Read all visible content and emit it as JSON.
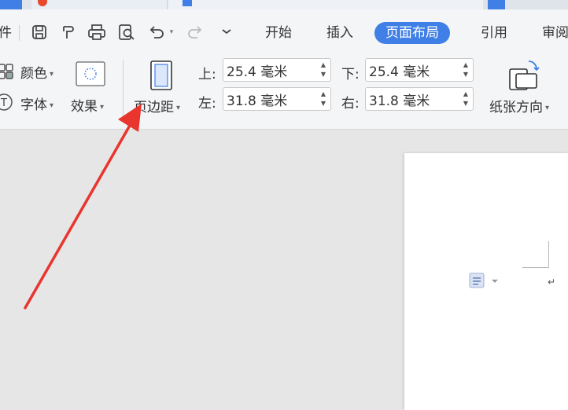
{
  "menu_tabs": {
    "partial_left": "件",
    "home": "开始",
    "insert": "插入",
    "page_layout": "页面布局",
    "references": "引用",
    "review": "审阅"
  },
  "toolbar": {
    "colors_label": "颜色",
    "fonts_label": "字体",
    "effects_label": "效果",
    "margins_label": "页边距",
    "orientation_label": "纸张方向"
  },
  "margins": {
    "top_label": "上:",
    "top_value": "25.4 毫米",
    "bottom_label": "下:",
    "bottom_value": "25.4 毫米",
    "left_label": "左:",
    "left_value": "31.8 毫米",
    "right_label": "右:",
    "right_value": "31.8 毫米"
  },
  "document": {
    "paragraph_mark": "↵"
  },
  "colors": {
    "accent": "#3f7fe6",
    "annotation_arrow": "#e8352e",
    "ribbon_bg": "#f4f5f7",
    "canvas_bg": "#e6e6e6"
  },
  "icons": [
    "save-icon",
    "format-painter-icon",
    "print-icon",
    "print-preview-icon",
    "undo-icon",
    "redo-icon",
    "customize-icon",
    "theme-colors-icon",
    "theme-fonts-icon",
    "theme-effects-icon",
    "margins-icon",
    "orientation-icon"
  ]
}
